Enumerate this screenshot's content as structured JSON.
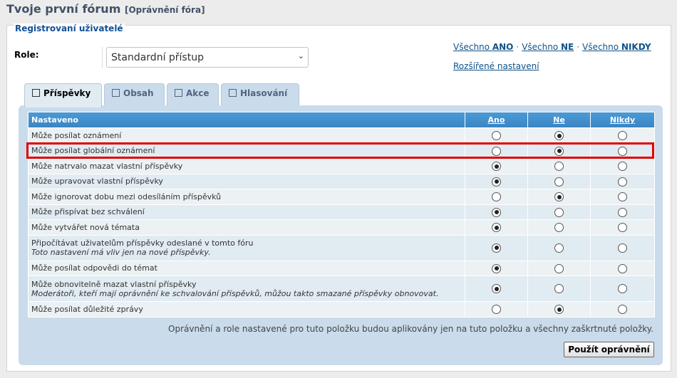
{
  "page": {
    "title": "Tvoje první fórum",
    "subtitle": "[Oprávnění fóra]"
  },
  "fieldset": {
    "legend": "Registrovaní uživatelé"
  },
  "role": {
    "label": "Role:",
    "selected": "Standardní přístup"
  },
  "quick_links": {
    "all_prefix": "Všechno",
    "yes": "ANO",
    "no": "NE",
    "never": "NIKDY",
    "advanced": "Rozšířené nastavení"
  },
  "tabs": [
    {
      "label": "Příspěvky",
      "active": true
    },
    {
      "label": "Obsah",
      "active": false
    },
    {
      "label": "Akce",
      "active": false
    },
    {
      "label": "Hlasování",
      "active": false
    }
  ],
  "table": {
    "headers": {
      "name": "Nastaveno",
      "yes": "Ano",
      "no": "Ne",
      "never": "Nikdy"
    },
    "rows": [
      {
        "label": "Může posílat oznámení",
        "explain": "",
        "value": "no"
      },
      {
        "label": "Může posílat globální oznámení",
        "explain": "",
        "value": "no"
      },
      {
        "label": "Může natrvalo mazat vlastní příspěvky",
        "explain": "",
        "value": "yes"
      },
      {
        "label": "Může upravovat vlastní příspěvky",
        "explain": "",
        "value": "yes"
      },
      {
        "label": "Může ignorovat dobu mezi odesíláním příspěvků",
        "explain": "",
        "value": "no"
      },
      {
        "label": "Může přispívat bez schválení",
        "explain": "",
        "value": "yes"
      },
      {
        "label": "Může vytvářet nová témata",
        "explain": "",
        "value": "yes"
      },
      {
        "label": "Připočítávat uživatelům příspěvky odeslané v tomto fóru",
        "explain": "Toto nastavení má vliv jen na nové příspěvky.",
        "value": "yes"
      },
      {
        "label": "Může posílat odpovědi do témat",
        "explain": "",
        "value": "yes"
      },
      {
        "label": "Může obnovitelně mazat vlastní příspěvky",
        "explain": "Moderátoři, kteří mají oprávnění ke schvalování příspěvků, můžou takto smazané příspěvky obnovovat.",
        "value": "yes"
      },
      {
        "label": "Může posílat důležité zprávy",
        "explain": "",
        "value": "no"
      }
    ]
  },
  "note": "Oprávnění a role nastavené pro tuto položku budou aplikovány jen na tuto položku a všechny zaškrtnuté položky.",
  "apply_button": "Použít oprávnění",
  "colors": {
    "header_blue": "#3a84c1",
    "link_blue": "#105289",
    "highlight_red": "#e00000",
    "tab_bg": "#cadceb"
  },
  "icons": [
    "chevron-down-icon",
    "checkbox-icon",
    "radio-icon"
  ]
}
